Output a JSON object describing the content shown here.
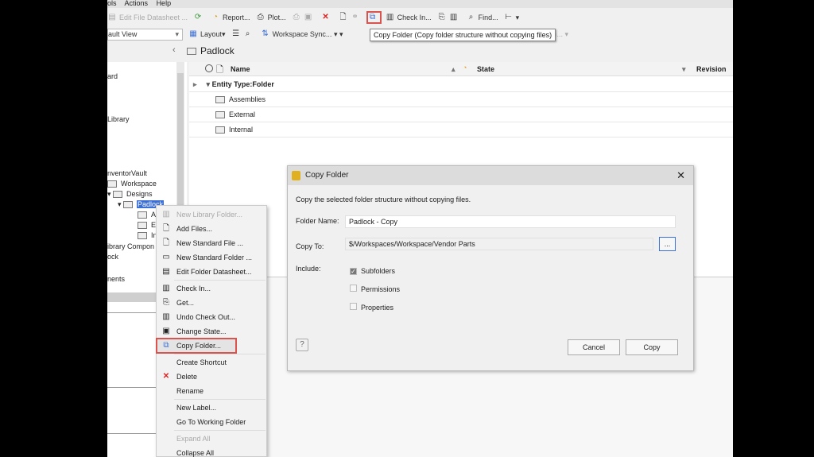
{
  "menubar": [
    "ols",
    "Actions",
    "Help"
  ],
  "toolbar1": {
    "edit_file_datasheet": "Edit File Datasheet ...",
    "report": "Report...",
    "plot": "Plot...",
    "check_in": "Check In...",
    "find": "Find..."
  },
  "toolbar2": {
    "view_select": "ault View",
    "layout": "Layout",
    "workspace_sync": "Workspace Sync...",
    "change_revision": "ge Revision..."
  },
  "tooltip": "Copy Folder (Copy folder structure without copying files)",
  "breadcrumb": "Padlock",
  "left_tree": [
    "ard",
    "Library",
    "nventorVault",
    "Workspace",
    "Designs",
    "Padlock",
    "As",
    "Ex",
    "In",
    "ibrary Compon",
    "ock",
    "nents"
  ],
  "grid": {
    "columns": {
      "name": "Name",
      "state": "State",
      "revision": "Revision"
    },
    "group": "Entity Type:Folder",
    "rows": [
      "Assemblies",
      "External",
      "Internal"
    ]
  },
  "context_menu": [
    {
      "label": "New Library Folder...",
      "disabled": true,
      "icon": "library-folder-icon"
    },
    {
      "label": "Add Files...",
      "icon": "add-file-icon"
    },
    {
      "label": "New Standard File ...",
      "icon": "new-file-icon"
    },
    {
      "label": "New Standard Folder ...",
      "icon": "new-folder-icon"
    },
    {
      "label": "Edit Folder Datasheet...",
      "icon": "datasheet-icon"
    },
    {
      "label": "Check In...",
      "icon": "check-in-icon"
    },
    {
      "label": "Get...",
      "icon": "get-icon"
    },
    {
      "label": "Undo Check Out...",
      "icon": "undo-checkout-icon"
    },
    {
      "label": "Change State...",
      "icon": "change-state-icon"
    },
    {
      "label": "Copy Folder...",
      "icon": "copy-folder-icon",
      "highlighted": true
    },
    {
      "label": "Create Shortcut"
    },
    {
      "label": "Delete",
      "icon": "delete-icon"
    },
    {
      "label": "Rename"
    },
    {
      "label": "New Label..."
    },
    {
      "label": "Go To Working Folder"
    },
    {
      "label": "Expand All",
      "disabled": true
    },
    {
      "label": "Collapse All"
    }
  ],
  "dialog": {
    "title": "Copy Folder",
    "description": "Copy the selected folder structure without copying files.",
    "folder_name_label": "Folder Name:",
    "folder_name": "Padlock - Copy",
    "copy_to_label": "Copy To:",
    "copy_to": "$/Workspaces/Workspace/Vendor Parts",
    "browse": "...",
    "include_label": "Include:",
    "options": [
      {
        "label": "Subfolders",
        "checked": true
      },
      {
        "label": "Permissions",
        "checked": false
      },
      {
        "label": "Properties",
        "checked": false
      }
    ],
    "cancel": "Cancel",
    "copy": "Copy"
  },
  "colors": {
    "highlight": "#d9534f",
    "selection": "#3b6fd4"
  }
}
